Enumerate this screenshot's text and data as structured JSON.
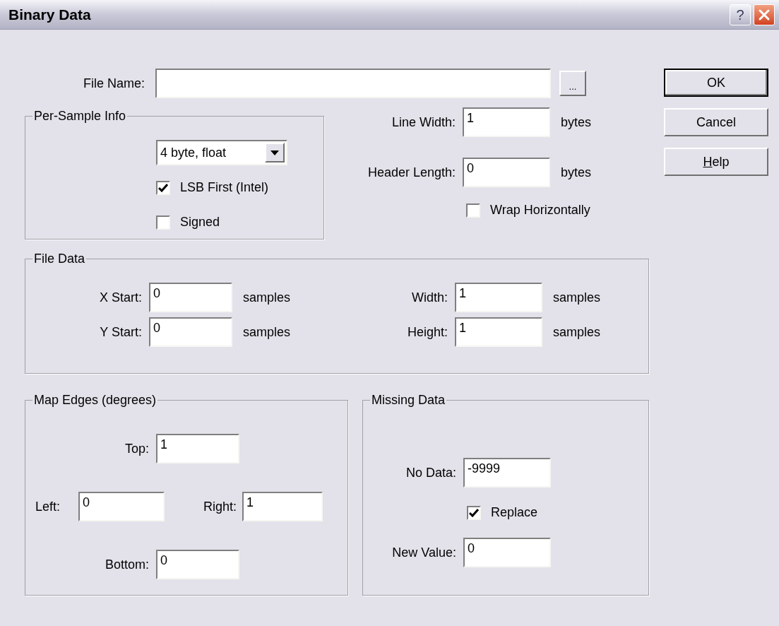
{
  "window": {
    "title": "Binary Data",
    "help_glyph": "?"
  },
  "file_name": {
    "label": "File Name:",
    "browse": "..."
  },
  "buttons": [
    {
      "label": "OK",
      "default": true,
      "mnemonic_underlined": false
    },
    {
      "label": "Cancel",
      "default": false,
      "mnemonic_underlined": false
    },
    {
      "label": "Help",
      "default": false,
      "mnemonic_underlined": true
    }
  ],
  "per_sample": {
    "title": "Per-Sample Info",
    "type": "4 byte, float",
    "checkboxes": [
      {
        "label": "LSB First (Intel)",
        "checked": true
      },
      {
        "label": "Signed",
        "checked": false
      }
    ]
  },
  "line_layout": {
    "fields": [
      {
        "label": "Line Width:",
        "value": "1",
        "unit": "bytes"
      },
      {
        "label": "Header Length:",
        "value": "0",
        "unit": "bytes"
      }
    ],
    "wrap": {
      "label": "Wrap Horizontally",
      "checked": false
    }
  },
  "file_data": {
    "title": "File Data",
    "fields": [
      {
        "label": "X Start:",
        "value": "0",
        "unit": "samples"
      },
      {
        "label": "Width:",
        "value": "1",
        "unit": "samples"
      },
      {
        "label": "Y Start:",
        "value": "0",
        "unit": "samples"
      },
      {
        "label": "Height:",
        "value": "1",
        "unit": "samples"
      }
    ]
  },
  "map_edges": {
    "title": "Map Edges (degrees)",
    "top": {
      "label": "Top:",
      "value": "1"
    },
    "left": {
      "label": "Left:",
      "value": "0"
    },
    "right": {
      "label": "Right:",
      "value": "1"
    },
    "bottom": {
      "label": "Bottom:",
      "value": "0"
    }
  },
  "missing_data": {
    "title": "Missing Data",
    "no_data": {
      "label": "No Data:",
      "value": "-9999"
    },
    "replace": {
      "label": "Replace",
      "checked": true
    },
    "new_value": {
      "label": "New Value:",
      "value": "0"
    }
  }
}
